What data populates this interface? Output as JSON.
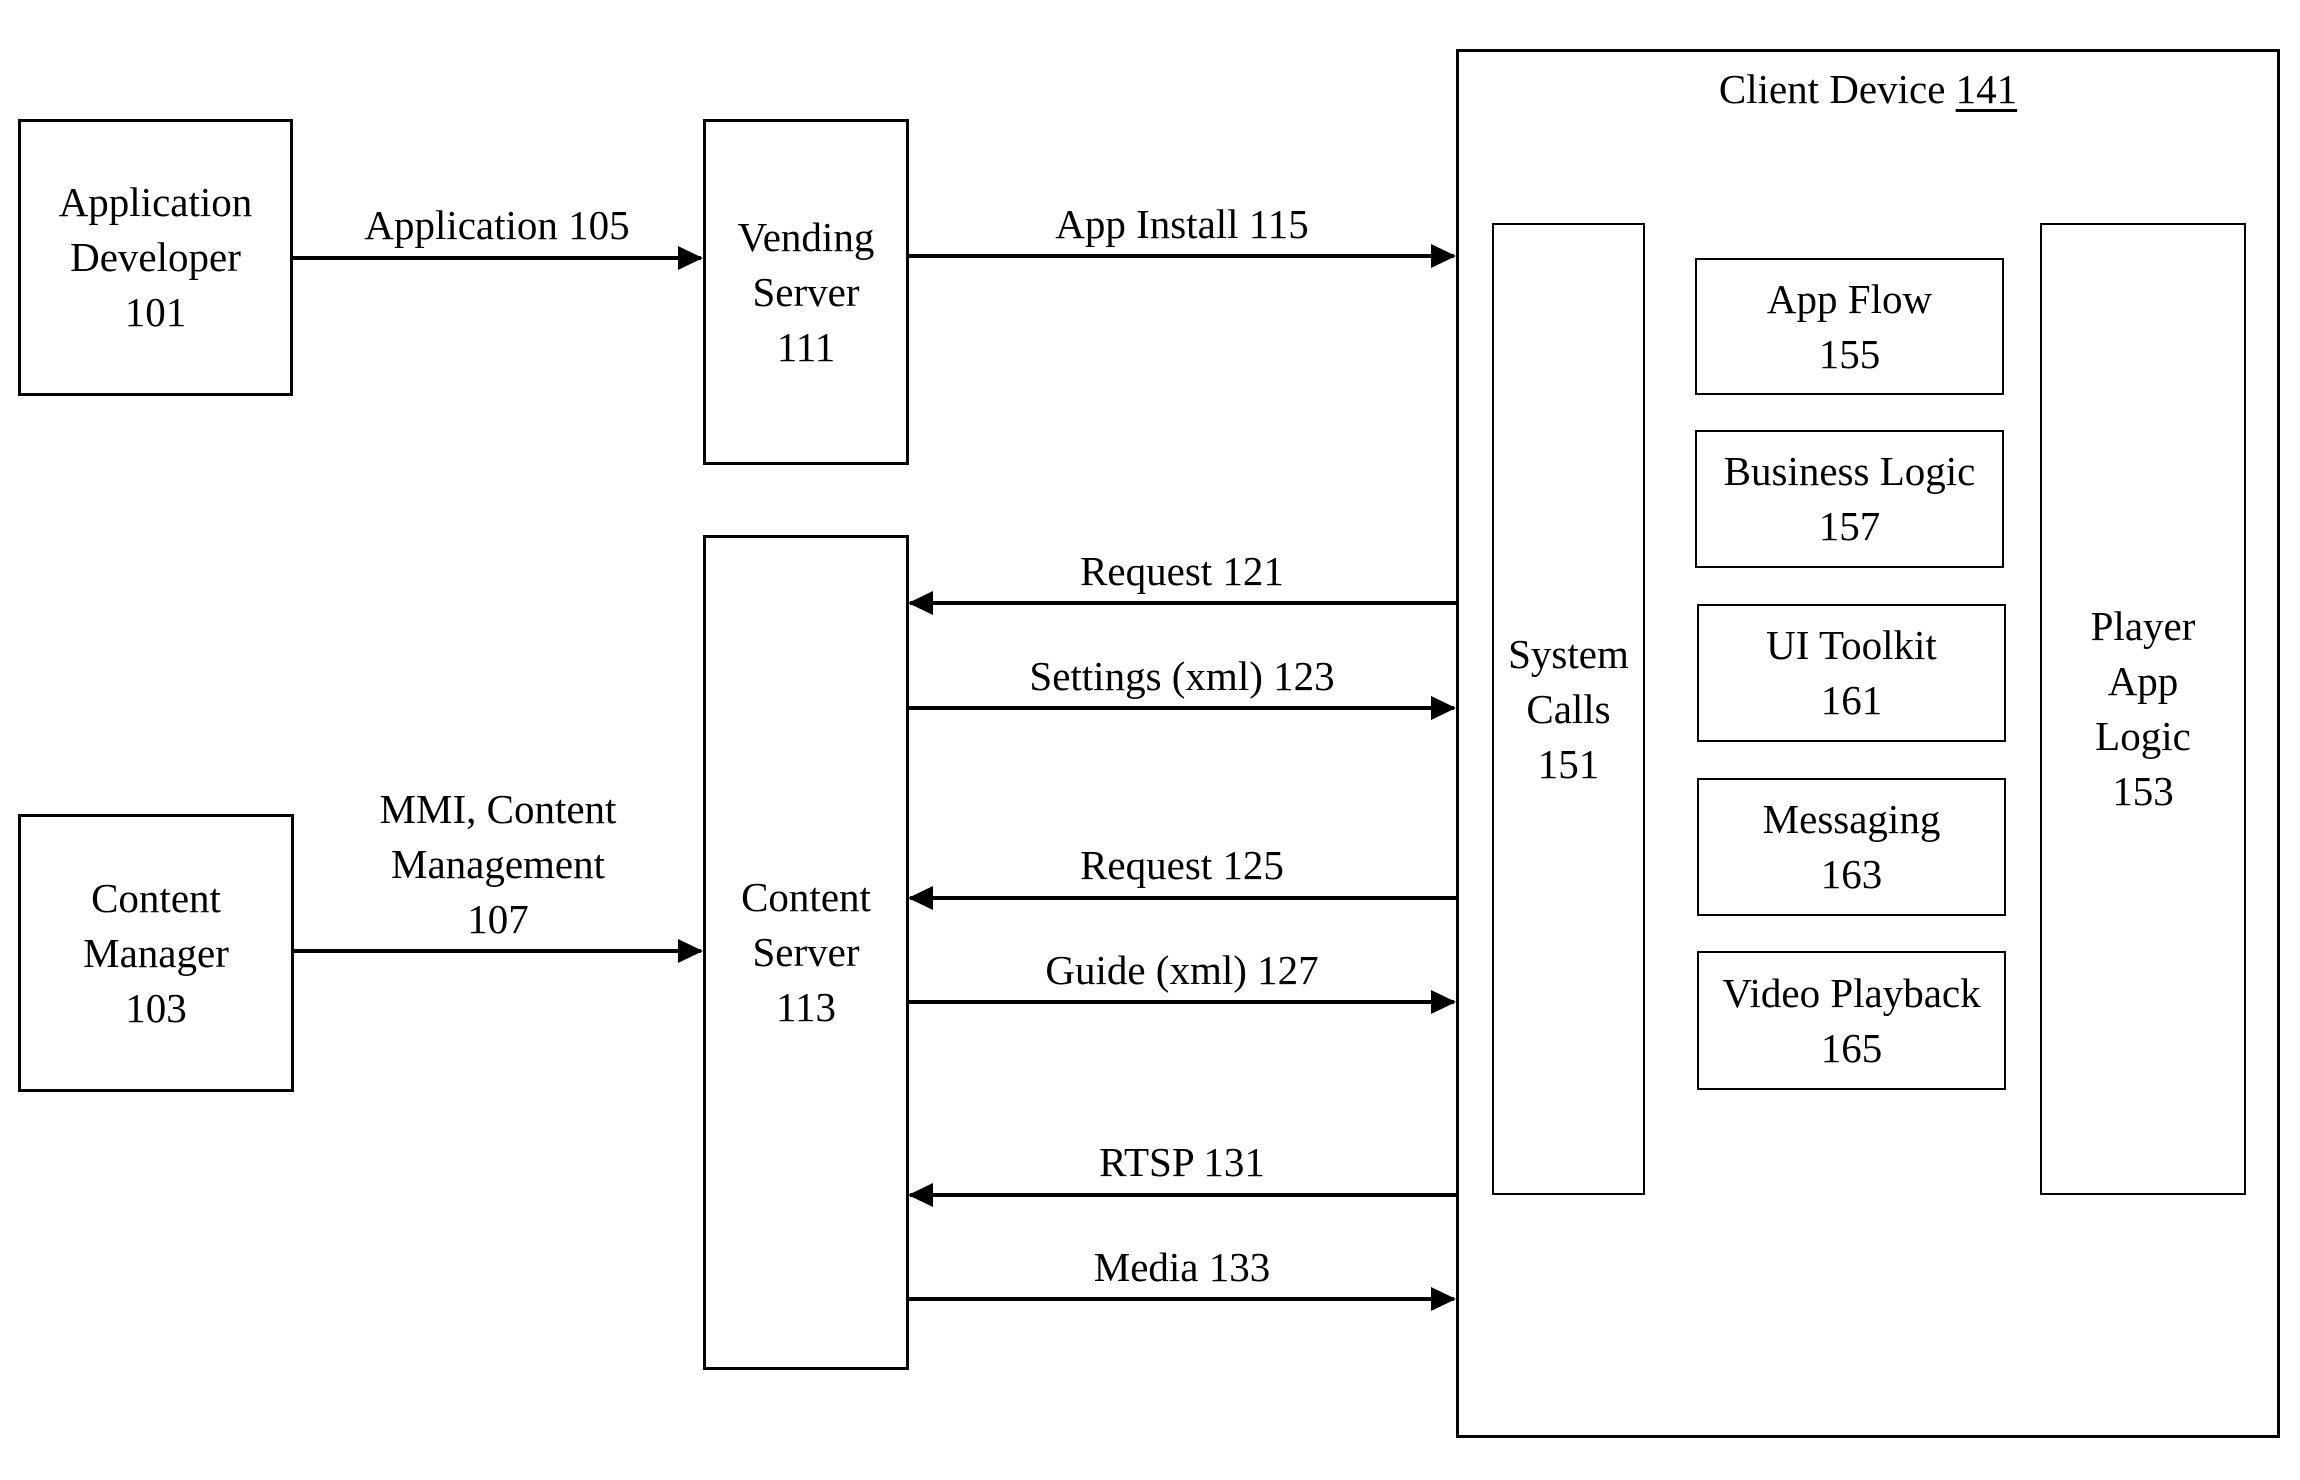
{
  "nodes": {
    "app_developer": {
      "lines": [
        "Application",
        "Developer",
        "101"
      ]
    },
    "vending_server": {
      "lines": [
        "Vending",
        "Server",
        "111"
      ]
    },
    "content_manager": {
      "lines": [
        "Content",
        "Manager",
        "103"
      ]
    },
    "content_server": {
      "lines": [
        "Content",
        "Server",
        "113"
      ]
    },
    "client_device": {
      "title": "Client Device",
      "number": "141"
    },
    "system_calls": {
      "lines": [
        "System",
        "Calls",
        "151"
      ]
    },
    "player_app_logic": {
      "lines": [
        "Player",
        "App",
        "Logic",
        "153"
      ]
    },
    "app_flow": {
      "lines": [
        "App Flow",
        "155"
      ]
    },
    "business_logic": {
      "lines": [
        "Business Logic",
        "157"
      ]
    },
    "ui_toolkit": {
      "lines": [
        "UI Toolkit",
        "161"
      ]
    },
    "messaging": {
      "lines": [
        "Messaging",
        "163"
      ]
    },
    "video_playback": {
      "lines": [
        "Video Playback",
        "165"
      ]
    }
  },
  "edges": [
    {
      "id": "application-105",
      "from": "Application Developer 101",
      "to": "Vending Server 111",
      "label": [
        "Application 105"
      ]
    },
    {
      "id": "app-install-115",
      "from": "Vending Server 111",
      "to": "Client Device 141",
      "label": [
        "App Install 115"
      ]
    },
    {
      "id": "mmi-107",
      "from": "Content Manager 103",
      "to": "Content Server 113",
      "label": [
        "MMI, Content",
        "Management",
        "107"
      ]
    },
    {
      "id": "request-121",
      "from": "Client Device 141",
      "to": "Content Server 113",
      "label": [
        "Request 121"
      ]
    },
    {
      "id": "settings-123",
      "from": "Content Server 113",
      "to": "Client Device 141",
      "label": [
        "Settings (xml) 123"
      ]
    },
    {
      "id": "request-125",
      "from": "Client Device 141",
      "to": "Content Server 113",
      "label": [
        "Request 125"
      ]
    },
    {
      "id": "guide-127",
      "from": "Content Server 113",
      "to": "Client Device 141",
      "label": [
        "Guide (xml) 127"
      ]
    },
    {
      "id": "rtsp-131",
      "from": "Client Device 141",
      "to": "Content Server 113",
      "label": [
        "RTSP 131"
      ]
    },
    {
      "id": "media-133",
      "from": "Content Server 113",
      "to": "Client Device 141",
      "label": [
        "Media 133"
      ]
    }
  ]
}
